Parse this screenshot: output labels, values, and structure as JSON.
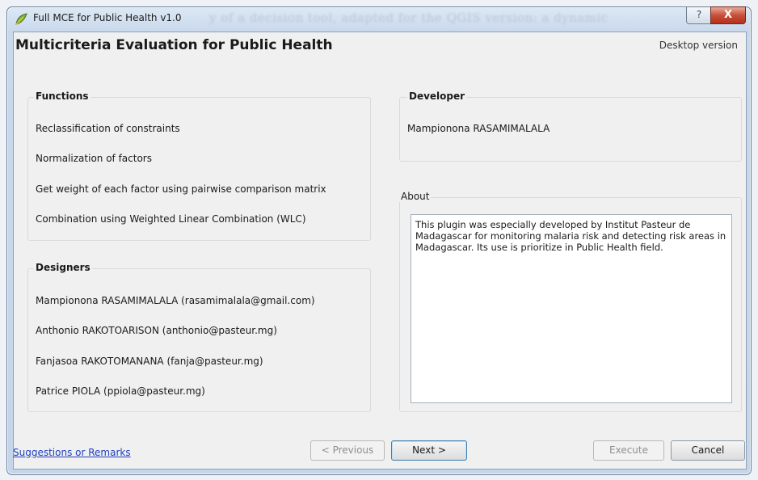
{
  "window": {
    "title": "Full MCE for Public Health v1.0",
    "background_title": "y of a decision tool, adapted for the QGIS version: a dynamic",
    "help_glyph": "?",
    "close_glyph": "X"
  },
  "header": {
    "title": "Multicriteria Evaluation for Public Health",
    "version": "Desktop version"
  },
  "functions": {
    "title": "Functions",
    "items": [
      "Reclassification of constraints",
      "Normalization of factors",
      "Get weight of each factor using pairwise comparison matrix",
      "Combination using Weighted Linear Combination (WLC)"
    ]
  },
  "designers": {
    "title": "Designers",
    "items": [
      "Mampionona RASAMIMALALA (rasamimalala@gmail.com)",
      "Anthonio RAKOTOARISON (anthonio@pasteur.mg)",
      "Fanjasoa RAKOTOMANANA (fanja@pasteur.mg)",
      "Patrice PIOLA (ppiola@pasteur.mg)"
    ]
  },
  "developer": {
    "title": "Developer",
    "name": "Mampionona RASAMIMALALA"
  },
  "about": {
    "title": "About",
    "text": "This plugin was especially developed by Institut Pasteur de Madagascar for monitoring malaria risk and detecting risk areas in Madagascar. Its use is prioritize in Public Health field."
  },
  "footer": {
    "link": "Suggestions or Remarks",
    "previous": "< Previous",
    "next": "Next >",
    "execute": "Execute",
    "cancel": "Cancel"
  },
  "colors": {
    "link": "#1f3fbf",
    "close_button": "#c75038",
    "disabled_text": "#8f8f8f"
  },
  "icons": {
    "app": "qgis-leaf-icon",
    "help": "help-icon",
    "close": "close-icon"
  }
}
